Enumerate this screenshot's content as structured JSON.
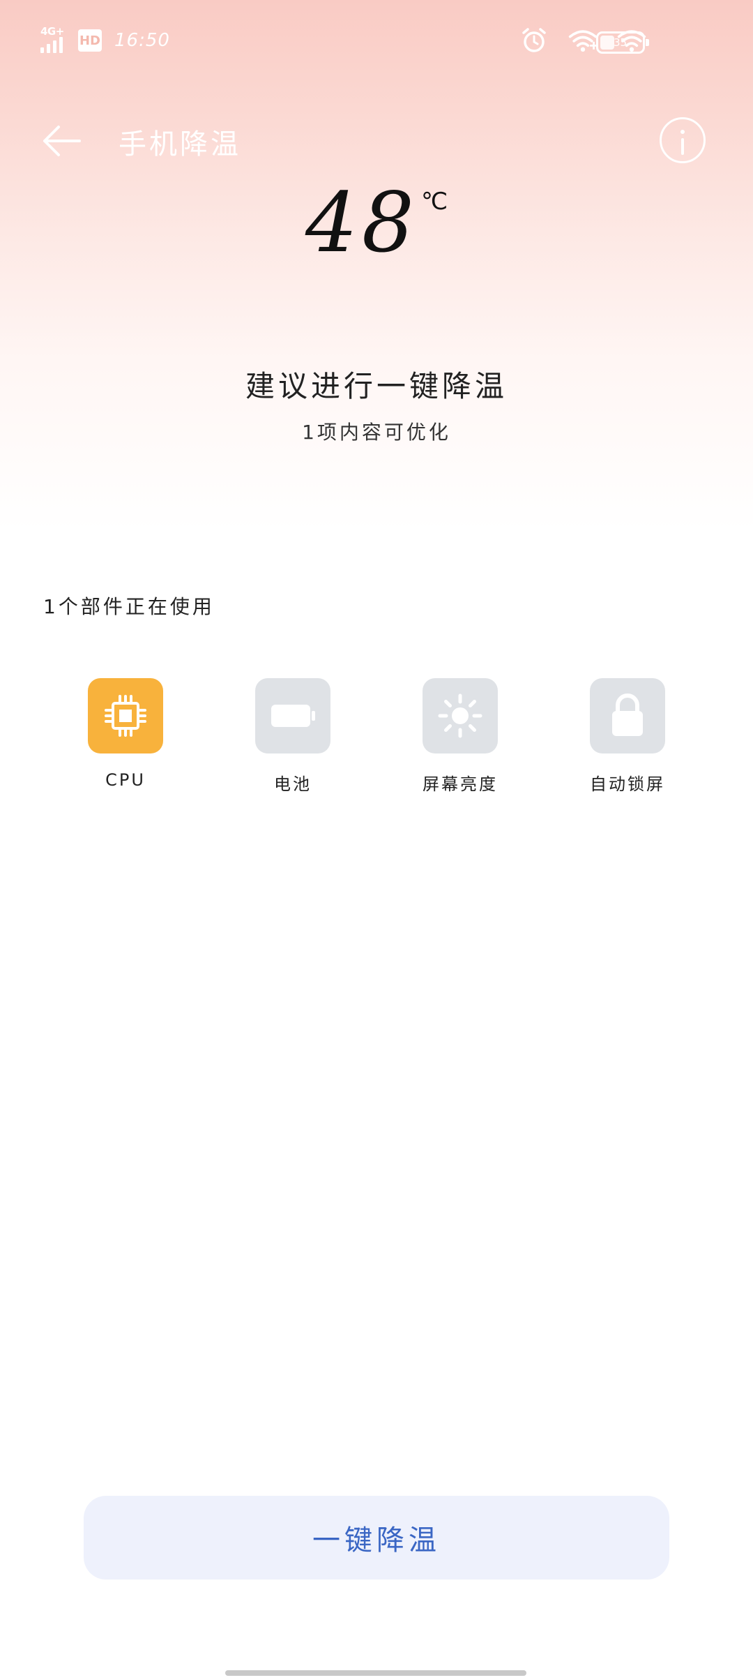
{
  "status_bar": {
    "network_tag": "4G+",
    "hd_label": "HD",
    "time": "16:50",
    "battery_percent": "35",
    "battery_level": 0.35
  },
  "header": {
    "title": "手机降温"
  },
  "temperature": {
    "value": "48",
    "unit": "℃"
  },
  "suggestion": {
    "headline": "建议进行一键降温",
    "detail": "1项内容可优化"
  },
  "components": {
    "title": "1个部件正在使用",
    "items": [
      {
        "label": "CPU",
        "icon": "cpu-icon",
        "active": true,
        "color": "#f8b23c"
      },
      {
        "label": "电池",
        "icon": "battery-icon",
        "active": false,
        "color": "#dfe2e6"
      },
      {
        "label": "屏幕亮度",
        "icon": "brightness-icon",
        "active": false,
        "color": "#dfe2e6"
      },
      {
        "label": "自动锁屏",
        "icon": "lock-icon",
        "active": false,
        "color": "#dfe2e6"
      }
    ]
  },
  "action": {
    "label": "一键降温",
    "color": "#3a66c4"
  }
}
